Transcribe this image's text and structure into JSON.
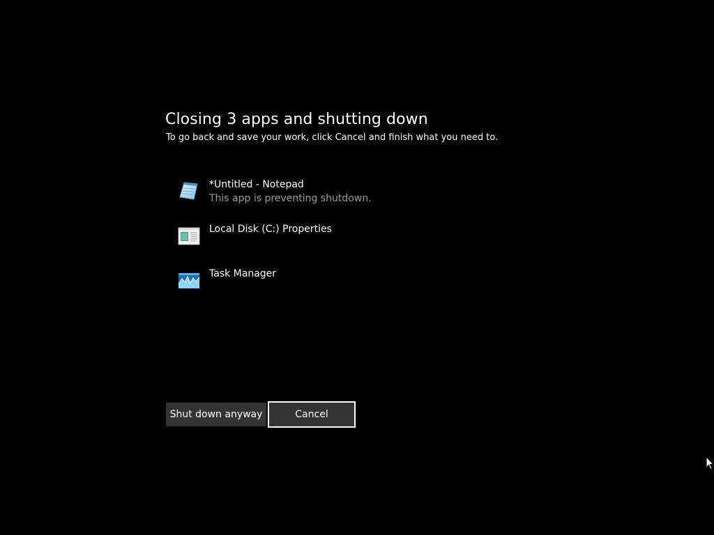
{
  "dialog": {
    "title": "Closing 3 apps and shutting down",
    "subtitle": "To go back and save your work, click Cancel and finish what you need to."
  },
  "apps": [
    {
      "name": "*Untitled - Notepad",
      "status": "This app is preventing shutdown.",
      "icon": "notepad-icon"
    },
    {
      "name": "Local Disk (C:) Properties",
      "status": "",
      "icon": "properties-window-icon"
    },
    {
      "name": "Task Manager",
      "status": "",
      "icon": "task-manager-icon"
    }
  ],
  "buttons": {
    "shutdown_label": "Shut down anyway",
    "cancel_label": "Cancel"
  },
  "colors": {
    "background": "#000000",
    "button_bg": "#333333",
    "focus_border": "#ffffff",
    "status_text": "#9a9a9a"
  }
}
